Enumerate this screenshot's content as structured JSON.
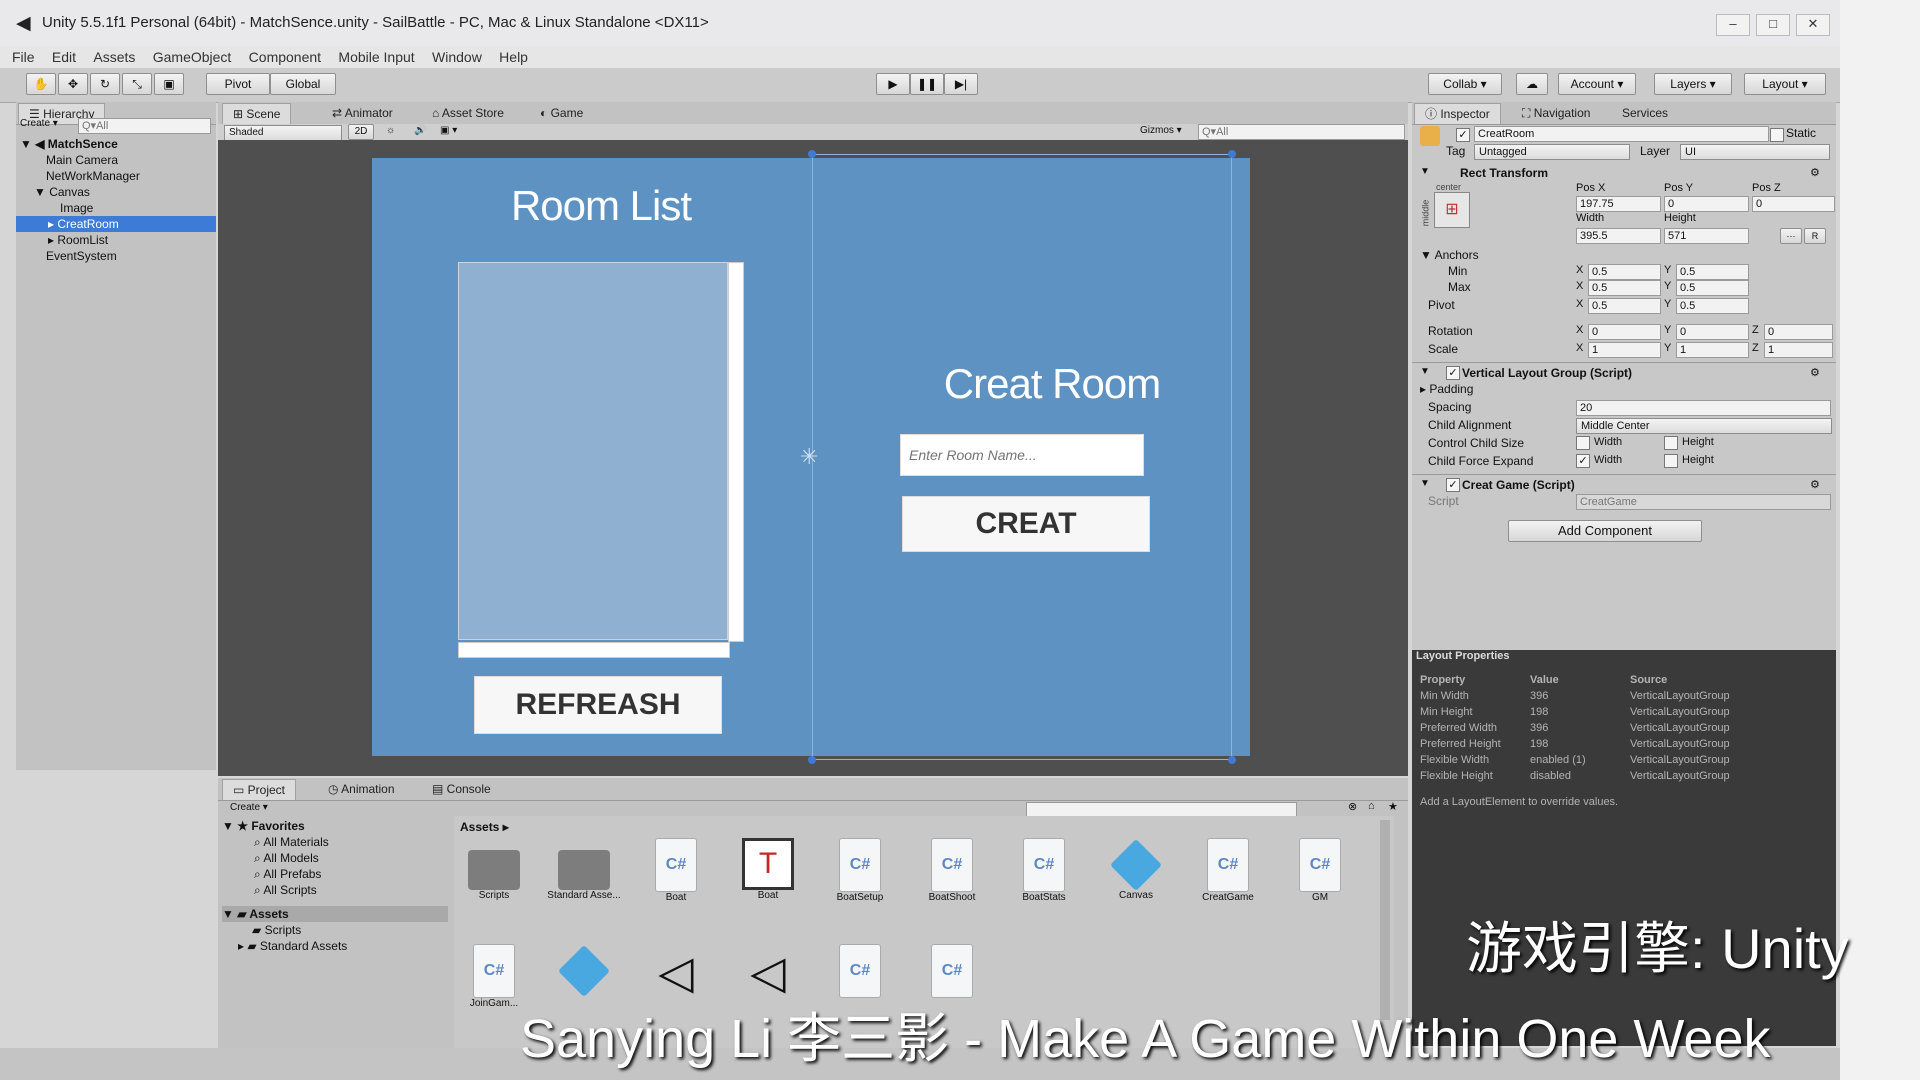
{
  "window": {
    "title": "Unity 5.5.1f1 Personal (64bit) - MatchSence.unity - SailBattle - PC, Mac & Linux Standalone <DX11>"
  },
  "menu": [
    "File",
    "Edit",
    "Assets",
    "GameObject",
    "Component",
    "Mobile Input",
    "Window",
    "Help"
  ],
  "toolbar": {
    "pivot": "Pivot",
    "global": "Global",
    "collab": "Collab ▾",
    "account": "Account",
    "layers": "Layers",
    "layout": "Layout"
  },
  "hierarchy": {
    "tab": "Hierarchy",
    "create": "Create ▾",
    "search_placeholder": "Q▾All",
    "scene": "MatchSence",
    "items": [
      "Main Camera",
      "NetWorkManager",
      "Canvas",
      "Image",
      "CreatRoom",
      "RoomList",
      "EventSystem"
    ]
  },
  "scene_tabs": [
    "Scene",
    "Animator",
    "Asset Store",
    "Game"
  ],
  "scene_toolbar": {
    "shaded": "Shaded",
    "mode2d": "2D",
    "gizmos": "Gizmos ▾",
    "search_placeholder": "Q▾All"
  },
  "game_ui": {
    "room_list_title": "Room List",
    "creat_room_title": "Creat Room",
    "room_name_placeholder": "Enter Room Name...",
    "creat_button": "CREAT",
    "refresh_button": "REFREASH"
  },
  "inspector": {
    "tabs": [
      "Inspector",
      "Navigation",
      "Services"
    ],
    "object_name": "CreatRoom",
    "static_label": "Static",
    "tag_label": "Tag",
    "tag_value": "Untagged",
    "layer_label": "Layer",
    "layer_value": "UI",
    "rect_transform": {
      "title": "Rect Transform",
      "anchor_h": "center",
      "anchor_v": "middle",
      "pos_x_label": "Pos X",
      "pos_y_label": "Pos Y",
      "pos_z_label": "Pos Z",
      "pos_x": "197.75",
      "pos_y": "0",
      "pos_z": "0",
      "width_label": "Width",
      "height_label": "Height",
      "width": "395.5",
      "height": "571",
      "anchors_label": "Anchors",
      "min_label": "Min",
      "max_label": "Max",
      "pivot_label": "Pivot",
      "anchor_min_x": "0.5",
      "anchor_min_y": "0.5",
      "anchor_max_x": "0.5",
      "anchor_max_y": "0.5",
      "pivot_x": "0.5",
      "pivot_y": "0.5",
      "rotation_label": "Rotation",
      "rot_x": "0",
      "rot_y": "0",
      "rot_z": "0",
      "scale_label": "Scale",
      "scale_x": "1",
      "scale_y": "1",
      "scale_z": "1"
    },
    "vertical_layout": {
      "title": "Vertical Layout Group (Script)",
      "padding": "Padding",
      "spacing_label": "Spacing",
      "spacing": "20",
      "child_alignment_label": "Child Alignment",
      "child_alignment": "Middle Center",
      "control_child_size": "Control Child Size",
      "child_force_expand": "Child Force Expand",
      "width": "Width",
      "height": "Height"
    },
    "creat_game": {
      "title": "Creat Game (Script)",
      "script_label": "Script",
      "script_value": "CreatGame"
    },
    "add_component": "Add Component"
  },
  "layout_properties": {
    "title": "Layout Properties",
    "headers": [
      "Property",
      "Value",
      "Source"
    ],
    "rows": [
      [
        "Min Width",
        "396",
        "VerticalLayoutGroup"
      ],
      [
        "Min Height",
        "198",
        "VerticalLayoutGroup"
      ],
      [
        "Preferred Width",
        "396",
        "VerticalLayoutGroup"
      ],
      [
        "Preferred Height",
        "198",
        "VerticalLayoutGroup"
      ],
      [
        "Flexible Width",
        "enabled (1)",
        "VerticalLayoutGroup"
      ],
      [
        "Flexible Height",
        "disabled",
        "VerticalLayoutGroup"
      ]
    ],
    "note": "Add a LayoutElement to override values."
  },
  "project": {
    "tabs": [
      "Project",
      "Animation",
      "Console"
    ],
    "create": "Create ▾",
    "favorites": "Favorites",
    "favorite_items": [
      "All Materials",
      "All Models",
      "All Prefabs",
      "All Scripts"
    ],
    "assets_root": "Assets",
    "asset_folders": [
      "Scripts",
      "Standard Assets"
    ],
    "breadcrumb": "Assets ▸",
    "assets_row1": [
      {
        "name": "Scripts",
        "kind": "folder"
      },
      {
        "name": "Standard Asse...",
        "kind": "folder"
      },
      {
        "name": "Boat",
        "kind": "script"
      },
      {
        "name": "Boat",
        "kind": "prefab-boat"
      },
      {
        "name": "BoatSetup",
        "kind": "script"
      },
      {
        "name": "BoatShoot",
        "kind": "script"
      },
      {
        "name": "BoatStats",
        "kind": "script"
      },
      {
        "name": "Canvas",
        "kind": "prefab"
      },
      {
        "name": "CreatGame",
        "kind": "script"
      },
      {
        "name": "GM",
        "kind": "script"
      }
    ],
    "assets_row2": [
      {
        "name": "JoinGam...",
        "kind": "script"
      },
      {
        "name": "",
        "kind": "prefab"
      },
      {
        "name": "",
        "kind": "unity"
      },
      {
        "name": "",
        "kind": "unity"
      },
      {
        "name": "",
        "kind": "script"
      },
      {
        "name": "",
        "kind": "script"
      }
    ]
  },
  "overlay": {
    "engine_line": "游戏引擎: Unity",
    "credit_line": "Sanying Li 李三影 - Make A Game Within One Week"
  }
}
